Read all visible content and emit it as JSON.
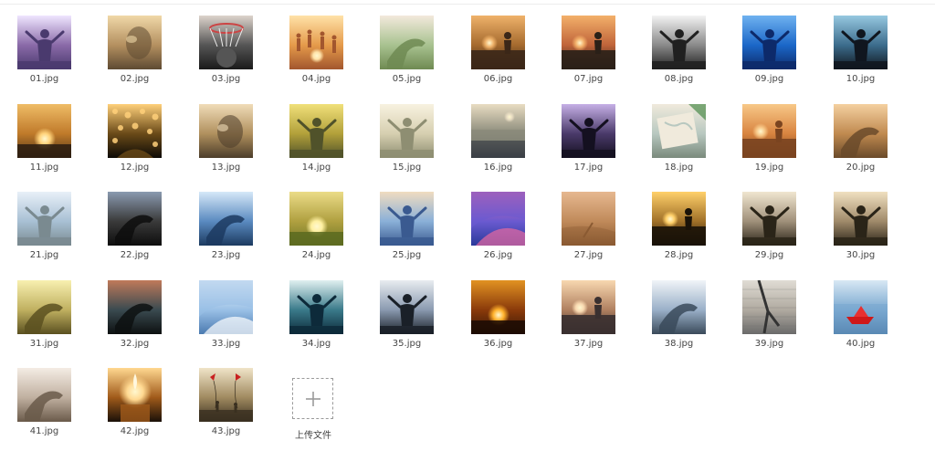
{
  "files": [
    {
      "name": "01.jpg",
      "colors": [
        "#4a3a6e",
        "#8a6aa8",
        "#efe6ff"
      ],
      "scene": "person"
    },
    {
      "name": "02.jpg",
      "colors": [
        "#5e4a32",
        "#b49060",
        "#f0d8a8"
      ],
      "scene": "face"
    },
    {
      "name": "03.jpg",
      "colors": [
        "#1a1a1a",
        "#555555",
        "#ddd4cc"
      ],
      "scene": "hoop"
    },
    {
      "name": "04.jpg",
      "colors": [
        "#a2562e",
        "#e59a4a",
        "#ffe2a8"
      ],
      "scene": "jump"
    },
    {
      "name": "05.jpg",
      "colors": [
        "#6f8a52",
        "#a8c290",
        "#f3e9dc"
      ],
      "scene": "hand"
    },
    {
      "name": "06.jpg",
      "colors": [
        "#3b2718",
        "#a56a2e",
        "#efb26a"
      ],
      "scene": "sunset-person"
    },
    {
      "name": "07.jpg",
      "colors": [
        "#2a2018",
        "#c0643a",
        "#f3b06a"
      ],
      "scene": "sunset-person"
    },
    {
      "name": "08.jpg",
      "colors": [
        "#202020",
        "#8a8a8a",
        "#f3f3f3"
      ],
      "scene": "person"
    },
    {
      "name": "09.jpg",
      "colors": [
        "#0d2a6a",
        "#1b67c8",
        "#6fb2f0"
      ],
      "scene": "person"
    },
    {
      "name": "10.jpg",
      "colors": [
        "#10161f",
        "#3c6c8c",
        "#96c8e0"
      ],
      "scene": "person"
    },
    {
      "name": "11.jpg",
      "colors": [
        "#2a1c10",
        "#c07a2a",
        "#ffd27a"
      ],
      "scene": "sun"
    },
    {
      "name": "12.jpg",
      "colors": [
        "#0d0a06",
        "#6a4a18",
        "#ffd07a"
      ],
      "scene": "bokeh"
    },
    {
      "name": "13.jpg",
      "colors": [
        "#4c3d2a",
        "#b0905e",
        "#f0dcb8"
      ],
      "scene": "face"
    },
    {
      "name": "14.jpg",
      "colors": [
        "#50522a",
        "#b2a03a",
        "#f0e07a"
      ],
      "scene": "person"
    },
    {
      "name": "15.jpg",
      "colors": [
        "#8e8e72",
        "#d6cfb0",
        "#f8f2e0"
      ],
      "scene": "person"
    },
    {
      "name": "16.jpg",
      "colors": [
        "#3a3f46",
        "#8a8a7a",
        "#e8dcc2"
      ],
      "scene": "sea"
    },
    {
      "name": "17.jpg",
      "colors": [
        "#141020",
        "#4a3a6a",
        "#c6b0e6"
      ],
      "scene": "person"
    },
    {
      "name": "18.jpg",
      "colors": [
        "#7a8a7c",
        "#b8c8c0",
        "#f0eadc"
      ],
      "scene": "map"
    },
    {
      "name": "19.jpg",
      "colors": [
        "#7a4420",
        "#d88440",
        "#f8c888"
      ],
      "scene": "sunset-person"
    },
    {
      "name": "20.jpg",
      "colors": [
        "#6a4a2a",
        "#c08a50",
        "#f4d0a0"
      ],
      "scene": "hand"
    },
    {
      "name": "21.jpg",
      "colors": [
        "#7a8a90",
        "#a8c0d4",
        "#e8f0f8"
      ],
      "scene": "person"
    },
    {
      "name": "22.jpg",
      "colors": [
        "#0d0d0d",
        "#3a3a3a",
        "#8a9ab0"
      ],
      "scene": "hand"
    },
    {
      "name": "23.jpg",
      "colors": [
        "#1c3a60",
        "#5a8ac0",
        "#d6e8f8"
      ],
      "scene": "hand"
    },
    {
      "name": "24.jpg",
      "colors": [
        "#5a6a20",
        "#b0a040",
        "#fff0a0"
      ],
      "scene": "sun"
    },
    {
      "name": "25.jpg",
      "colors": [
        "#3a5a90",
        "#8ab0d8",
        "#f0dcc0"
      ],
      "scene": "person"
    },
    {
      "name": "26.jpg",
      "colors": [
        "#2a3a9a",
        "#6a5ad0",
        "#e86aa0"
      ],
      "scene": "sky"
    },
    {
      "name": "27.jpg",
      "colors": [
        "#8a5a32",
        "#c08a5a",
        "#e6b890"
      ],
      "scene": "sand"
    },
    {
      "name": "28.jpg",
      "colors": [
        "#1a1208",
        "#a07028",
        "#ffd06a"
      ],
      "scene": "sunset-person"
    },
    {
      "name": "29.jpg",
      "colors": [
        "#2a2418",
        "#a0907a",
        "#f0e6d0"
      ],
      "scene": "person"
    },
    {
      "name": "30.jpg",
      "colors": [
        "#2a2418",
        "#a08a6a",
        "#f0e0c0"
      ],
      "scene": "person"
    },
    {
      "name": "31.jpg",
      "colors": [
        "#5a5020",
        "#c0b060",
        "#f8f0b0"
      ],
      "scene": "hand"
    },
    {
      "name": "32.jpg",
      "colors": [
        "#0d1010",
        "#3a4a50",
        "#c07a5a"
      ],
      "scene": "hand"
    },
    {
      "name": "33.jpg",
      "colors": [
        "#4a7ab0",
        "#9ac0e6",
        "#ffffff"
      ],
      "scene": "sky"
    },
    {
      "name": "34.jpg",
      "colors": [
        "#0d2a3a",
        "#3a7a8a",
        "#e0f0f0"
      ],
      "scene": "person"
    },
    {
      "name": "35.jpg",
      "colors": [
        "#1a2028",
        "#8a9ab0",
        "#e8ecf0"
      ],
      "scene": "person"
    },
    {
      "name": "36.jpg",
      "colors": [
        "#1a0a04",
        "#8a3a0a",
        "#ffb02a"
      ],
      "scene": "sun"
    },
    {
      "name": "37.jpg",
      "colors": [
        "#3a3030",
        "#b08060",
        "#f8d8b0"
      ],
      "scene": "sunset-person"
    },
    {
      "name": "38.jpg",
      "colors": [
        "#3a4a5a",
        "#9ab0c8",
        "#f0f4f8"
      ],
      "scene": "hand"
    },
    {
      "name": "39.jpg",
      "colors": [
        "#6a6a6a",
        "#b0aaa0",
        "#e0dcd4"
      ],
      "scene": "wall"
    },
    {
      "name": "40.jpg",
      "colors": [
        "#2a5a8a",
        "#7aa8d0",
        "#d8e8f4"
      ],
      "scene": "boat"
    },
    {
      "name": "41.jpg",
      "colors": [
        "#6a5a4a",
        "#c0b0a0",
        "#f4ece4"
      ],
      "scene": "hand"
    },
    {
      "name": "42.jpg",
      "colors": [
        "#1a1008",
        "#a05a1a",
        "#ffd890"
      ],
      "scene": "candle"
    },
    {
      "name": "43.jpg",
      "colors": [
        "#3a3020",
        "#a08a60",
        "#f0e4c8"
      ],
      "scene": "kite"
    }
  ],
  "upload": {
    "label": "上传文件",
    "icon": "plus-icon"
  }
}
